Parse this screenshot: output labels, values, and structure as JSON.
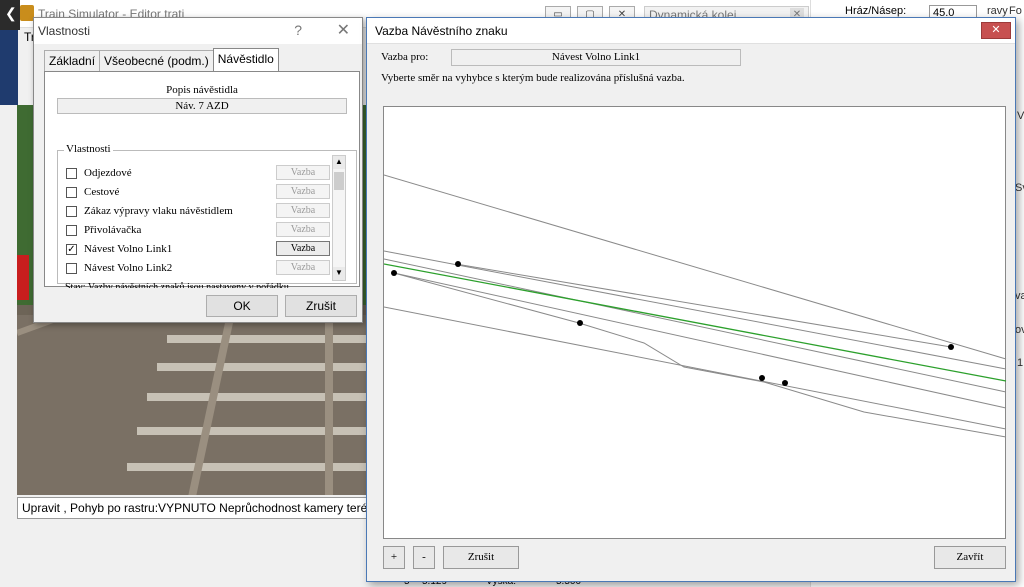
{
  "background_window": {
    "title": "Train Simulator - Editor trati",
    "tr_label": "Tr",
    "back_glyph": "❮",
    "window_buttons": [
      "▭",
      "▢",
      "✕"
    ],
    "dynamic_panel_title": "Dynamická kolej",
    "dynamic_close": "✕",
    "status_text": "Upravit , Pohyb po rastru:VYPNUTO Neprůchodnost kamery terénem"
  },
  "right_panel": {
    "label": "Hráz/Násep:",
    "value": "45.0",
    "side_texts": [
      "ravy",
      "Fo",
      "V",
      "Sv",
      "va",
      "ov",
      "1:"
    ],
    "bottom_row": [
      "5",
      "5.129",
      "Výška:",
      "5.500"
    ]
  },
  "properties_dialog": {
    "title": "Vlastnosti",
    "help": "?",
    "close": "✕",
    "tabs": [
      {
        "label": "Základní",
        "active": false
      },
      {
        "label": "Všeobecné (podm.)",
        "active": false
      },
      {
        "label": "Návěstidlo",
        "active": true
      }
    ],
    "popis_label": "Popis návěstidla",
    "popis_value": "Náv. 7 AZD",
    "group_label": "Vlastnosti",
    "rows": [
      {
        "label": "Odjezdové",
        "checked": false,
        "button": "Vazba",
        "enabled": false
      },
      {
        "label": "Cestové",
        "checked": false,
        "button": "Vazba",
        "enabled": false
      },
      {
        "label": "Zákaz výpravy vlaku návěstidlem",
        "checked": false,
        "button": "Vazba",
        "enabled": false
      },
      {
        "label": "Přivolávačka",
        "checked": false,
        "button": "Vazba",
        "enabled": false
      },
      {
        "label": "Návest Volno Link1",
        "checked": true,
        "button": "Vazba",
        "enabled": true
      },
      {
        "label": "Návest Volno Link2",
        "checked": false,
        "button": "Vazba",
        "enabled": false
      }
    ],
    "stav_text": "Stav: Vazby návěstních znaků jsou nastaveny v pořádku",
    "ok_label": "OK",
    "cancel_label": "Zrušit"
  },
  "vazba_dialog": {
    "title": "Vazba Návěstního znaku",
    "close": "✕",
    "for_label": "Vazba pro:",
    "for_value": "Návest Volno Link1",
    "instruction": "Vyberte směr na vyhybce s kterým bude realizována příslušná vazba.",
    "zoom_in": "+",
    "zoom_out": "-",
    "cancel_label": "Zrušit",
    "close_label": "Zavřít",
    "colors": {
      "track": "#8a8a8a",
      "selected": "#2ca02c",
      "node": "#000000"
    }
  }
}
